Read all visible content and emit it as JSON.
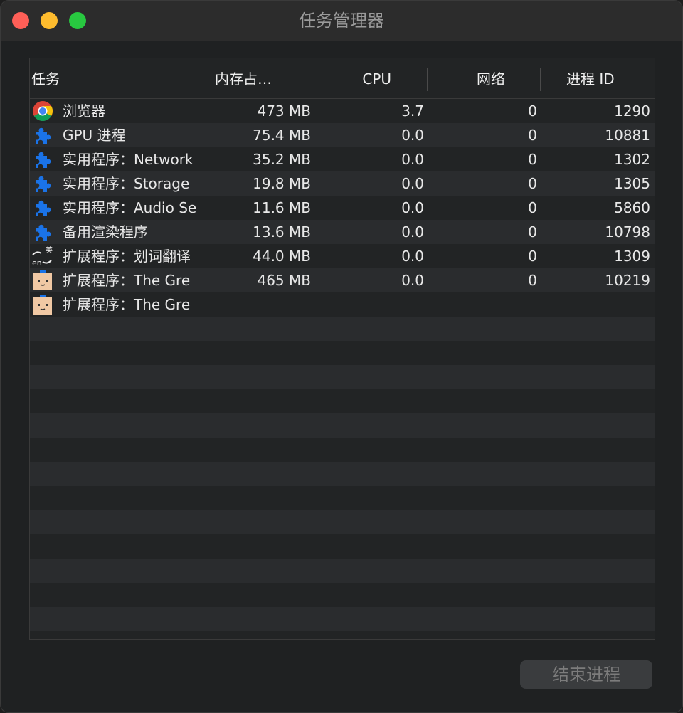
{
  "window": {
    "title": "任务管理器"
  },
  "columns": {
    "task": "任务",
    "memory": "内存占…",
    "cpu": "CPU",
    "network": "网络",
    "pid": "进程 ID"
  },
  "rows": [
    {
      "icon": "chrome-icon",
      "name": "浏览器",
      "memory": "473 MB",
      "cpu": "3.7",
      "network": "0",
      "pid": "1290"
    },
    {
      "icon": "puzzle-icon",
      "name": "GPU 进程",
      "memory": "75.4 MB",
      "cpu": "0.0",
      "network": "0",
      "pid": "10881"
    },
    {
      "icon": "puzzle-icon",
      "name": "实用程序：Network",
      "memory": "35.2 MB",
      "cpu": "0.0",
      "network": "0",
      "pid": "1302"
    },
    {
      "icon": "puzzle-icon",
      "name": "实用程序：Storage",
      "memory": "19.8 MB",
      "cpu": "0.0",
      "network": "0",
      "pid": "1305"
    },
    {
      "icon": "puzzle-icon",
      "name": "实用程序：Audio Se",
      "memory": "11.6 MB",
      "cpu": "0.0",
      "network": "0",
      "pid": "5860"
    },
    {
      "icon": "puzzle-icon",
      "name": "备用渲染程序",
      "memory": "13.6 MB",
      "cpu": "0.0",
      "network": "0",
      "pid": "10798"
    },
    {
      "icon": "translate-extension-icon",
      "name": "扩展程序：划词翻译",
      "memory": "44.0 MB",
      "cpu": "0.0",
      "network": "0",
      "pid": "1309"
    },
    {
      "icon": "great-suspender-icon",
      "name": "扩展程序：The Gre",
      "memory": "465 MB",
      "cpu": "0.0",
      "network": "0",
      "pid": "10219"
    },
    {
      "icon": "great-suspender-icon",
      "name": "扩展程序：The Gre",
      "memory": "",
      "cpu": "",
      "network": "",
      "pid": ""
    }
  ],
  "translate_icon_text": {
    "top": "英",
    "bottom": "en"
  },
  "buttons": {
    "end_process": "结束进程"
  },
  "colors": {
    "puzzle": "#1a73e8",
    "button_text": "#7c7c7c"
  }
}
